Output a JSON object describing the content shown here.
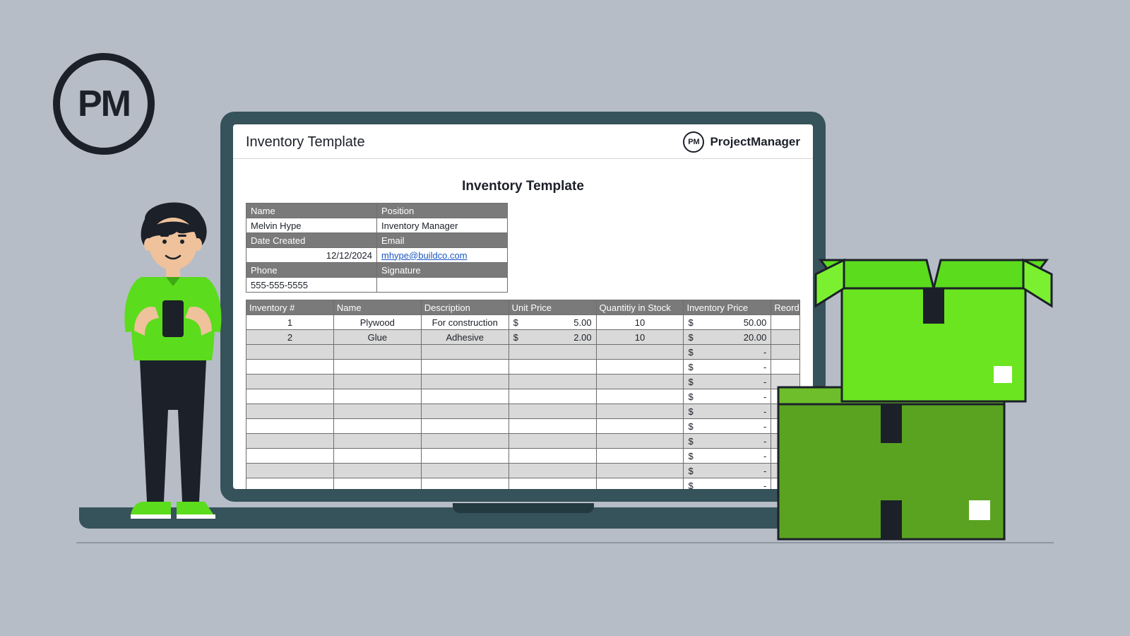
{
  "logo_text": "PM",
  "header": {
    "title": "Inventory Template",
    "brand_badge": "PM",
    "brand_name": "ProjectManager"
  },
  "document_title": "Inventory Template",
  "info": {
    "name_label": "Name",
    "name_value": "Melvin Hype",
    "position_label": "Position",
    "position_value": "Inventory Manager",
    "date_label": "Date Created",
    "date_value": "12/12/2024",
    "email_label": "Email",
    "email_value": "mhype@buildco.com",
    "phone_label": "Phone",
    "phone_value": "555-555-5555",
    "signature_label": "Signature",
    "signature_value": ""
  },
  "columns": {
    "c0": "Inventory #",
    "c1": "Name",
    "c2": "Description",
    "c3": "Unit Price",
    "c4": "Quantitiy in Stock",
    "c5": "Inventory Price",
    "c6": "Reord"
  },
  "rows": [
    {
      "num": "1",
      "name": "Plywood",
      "desc": "For construction",
      "unit": "5.00",
      "qty": "10",
      "inv": "50.00",
      "reord": ""
    },
    {
      "num": "2",
      "name": "Glue",
      "desc": "Adhesive",
      "unit": "2.00",
      "qty": "10",
      "inv": "20.00",
      "reord": ""
    }
  ],
  "currency": "$",
  "empty_value": "-",
  "empty_row_count": 10
}
